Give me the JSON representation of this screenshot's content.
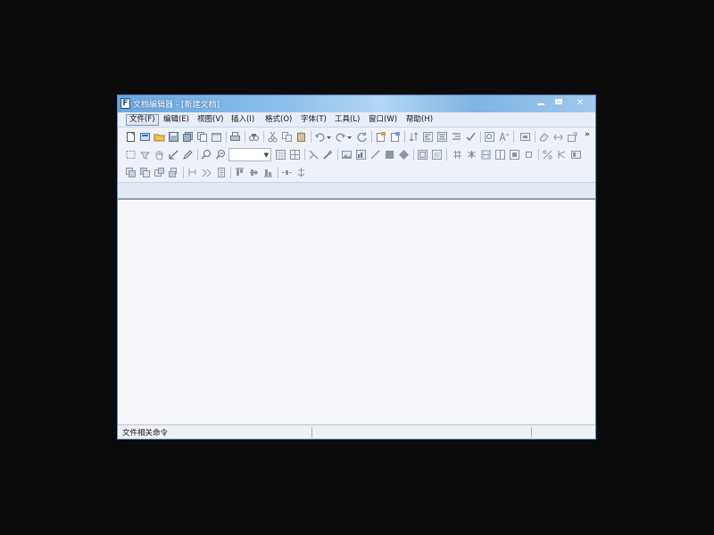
{
  "window": {
    "title": "文档编辑器 - [新建文档]",
    "icon_letter": "F",
    "controls": [
      "minimize-icon",
      "maximize-icon",
      "close-icon"
    ]
  },
  "menu": {
    "items": [
      {
        "label": "文件(F)"
      },
      {
        "label": "编辑(E)"
      },
      {
        "label": "视图(V)"
      },
      {
        "label": "插入(I)"
      },
      {
        "label": "格式(O)"
      },
      {
        "label": "字体(T)"
      },
      {
        "label": "工具(L)"
      },
      {
        "label": "窗口(W)"
      },
      {
        "label": "帮助(H)"
      }
    ]
  },
  "toolbar": {
    "overflow_label": "»",
    "combo_value": ""
  },
  "status": {
    "text": "文件相关命令"
  },
  "colors": {
    "titlebar": "#6aa5df",
    "window_border": "#5a86bd",
    "chrome": "#eef2f8",
    "document": "#f8f8fb"
  }
}
